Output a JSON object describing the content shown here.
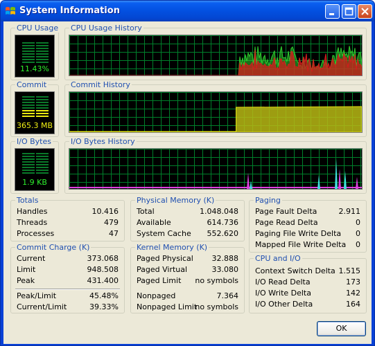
{
  "window": {
    "title": "System Information"
  },
  "meters": {
    "cpu": {
      "label": "CPU Usage",
      "value": "11.43%",
      "level": 0.11
    },
    "commit": {
      "label": "Commit",
      "value": "365.3 MB",
      "level": 0.39
    },
    "io": {
      "label": "I/O Bytes",
      "value": "1.9  KB",
      "level": 0.05
    }
  },
  "graphs": {
    "cpu_history": {
      "label": "CPU Usage History"
    },
    "commit_history": {
      "label": "Commit History"
    },
    "io_history": {
      "label": "I/O Bytes History"
    }
  },
  "totals": {
    "label": "Totals",
    "rows": [
      {
        "key": "Handles",
        "value": "10.416"
      },
      {
        "key": "Threads",
        "value": "479"
      },
      {
        "key": "Processes",
        "value": "47"
      }
    ]
  },
  "physical_memory": {
    "label": "Physical Memory (K)",
    "rows": [
      {
        "key": "Total",
        "value": "1.048.048"
      },
      {
        "key": "Available",
        "value": "614.736"
      },
      {
        "key": "System Cache",
        "value": "552.620"
      }
    ]
  },
  "paging": {
    "label": "Paging",
    "rows": [
      {
        "key": "Page Fault Delta",
        "value": "2.911"
      },
      {
        "key": "Page Read Delta",
        "value": "0"
      },
      {
        "key": "Paging File Write Delta",
        "value": "0"
      },
      {
        "key": "Mapped File Write Delta",
        "value": "0"
      }
    ]
  },
  "commit_charge": {
    "label": "Commit Charge (K)",
    "rows": [
      {
        "key": "Current",
        "value": "373.068"
      },
      {
        "key": "Limit",
        "value": "948.508"
      },
      {
        "key": "Peak",
        "value": "431.400"
      },
      {
        "key": "Peak/Limit",
        "value": "45.48%"
      },
      {
        "key": "Current/Limit",
        "value": "39.33%"
      }
    ]
  },
  "kernel_memory": {
    "label": "Kernel Memory (K)",
    "rows": [
      {
        "key": "Paged Physical",
        "value": "32.888"
      },
      {
        "key": "Paged Virtual",
        "value": "33.080"
      },
      {
        "key": "Paged Limit",
        "value": "no symbols"
      },
      {
        "key": "Nonpaged",
        "value": "7.364"
      },
      {
        "key": "Nonpaged Limit",
        "value": "no symbols"
      }
    ]
  },
  "cpu_io": {
    "label": "CPU and I/O",
    "rows": [
      {
        "key": "Context Switch Delta",
        "value": "1.515"
      },
      {
        "key": "I/O Read Delta",
        "value": "173"
      },
      {
        "key": "I/O Write Delta",
        "value": "142"
      },
      {
        "key": "I/O Other Delta",
        "value": "164"
      }
    ]
  },
  "ok_button": {
    "label": "OK"
  },
  "colors": {
    "grid": "#00802b",
    "cpu_fill": "#2ecc2e",
    "cpu_kernel": "#d41c1c",
    "commit_fill": "#b8b814",
    "io_read": "#e040e0",
    "io_write": "#40e0e0"
  }
}
